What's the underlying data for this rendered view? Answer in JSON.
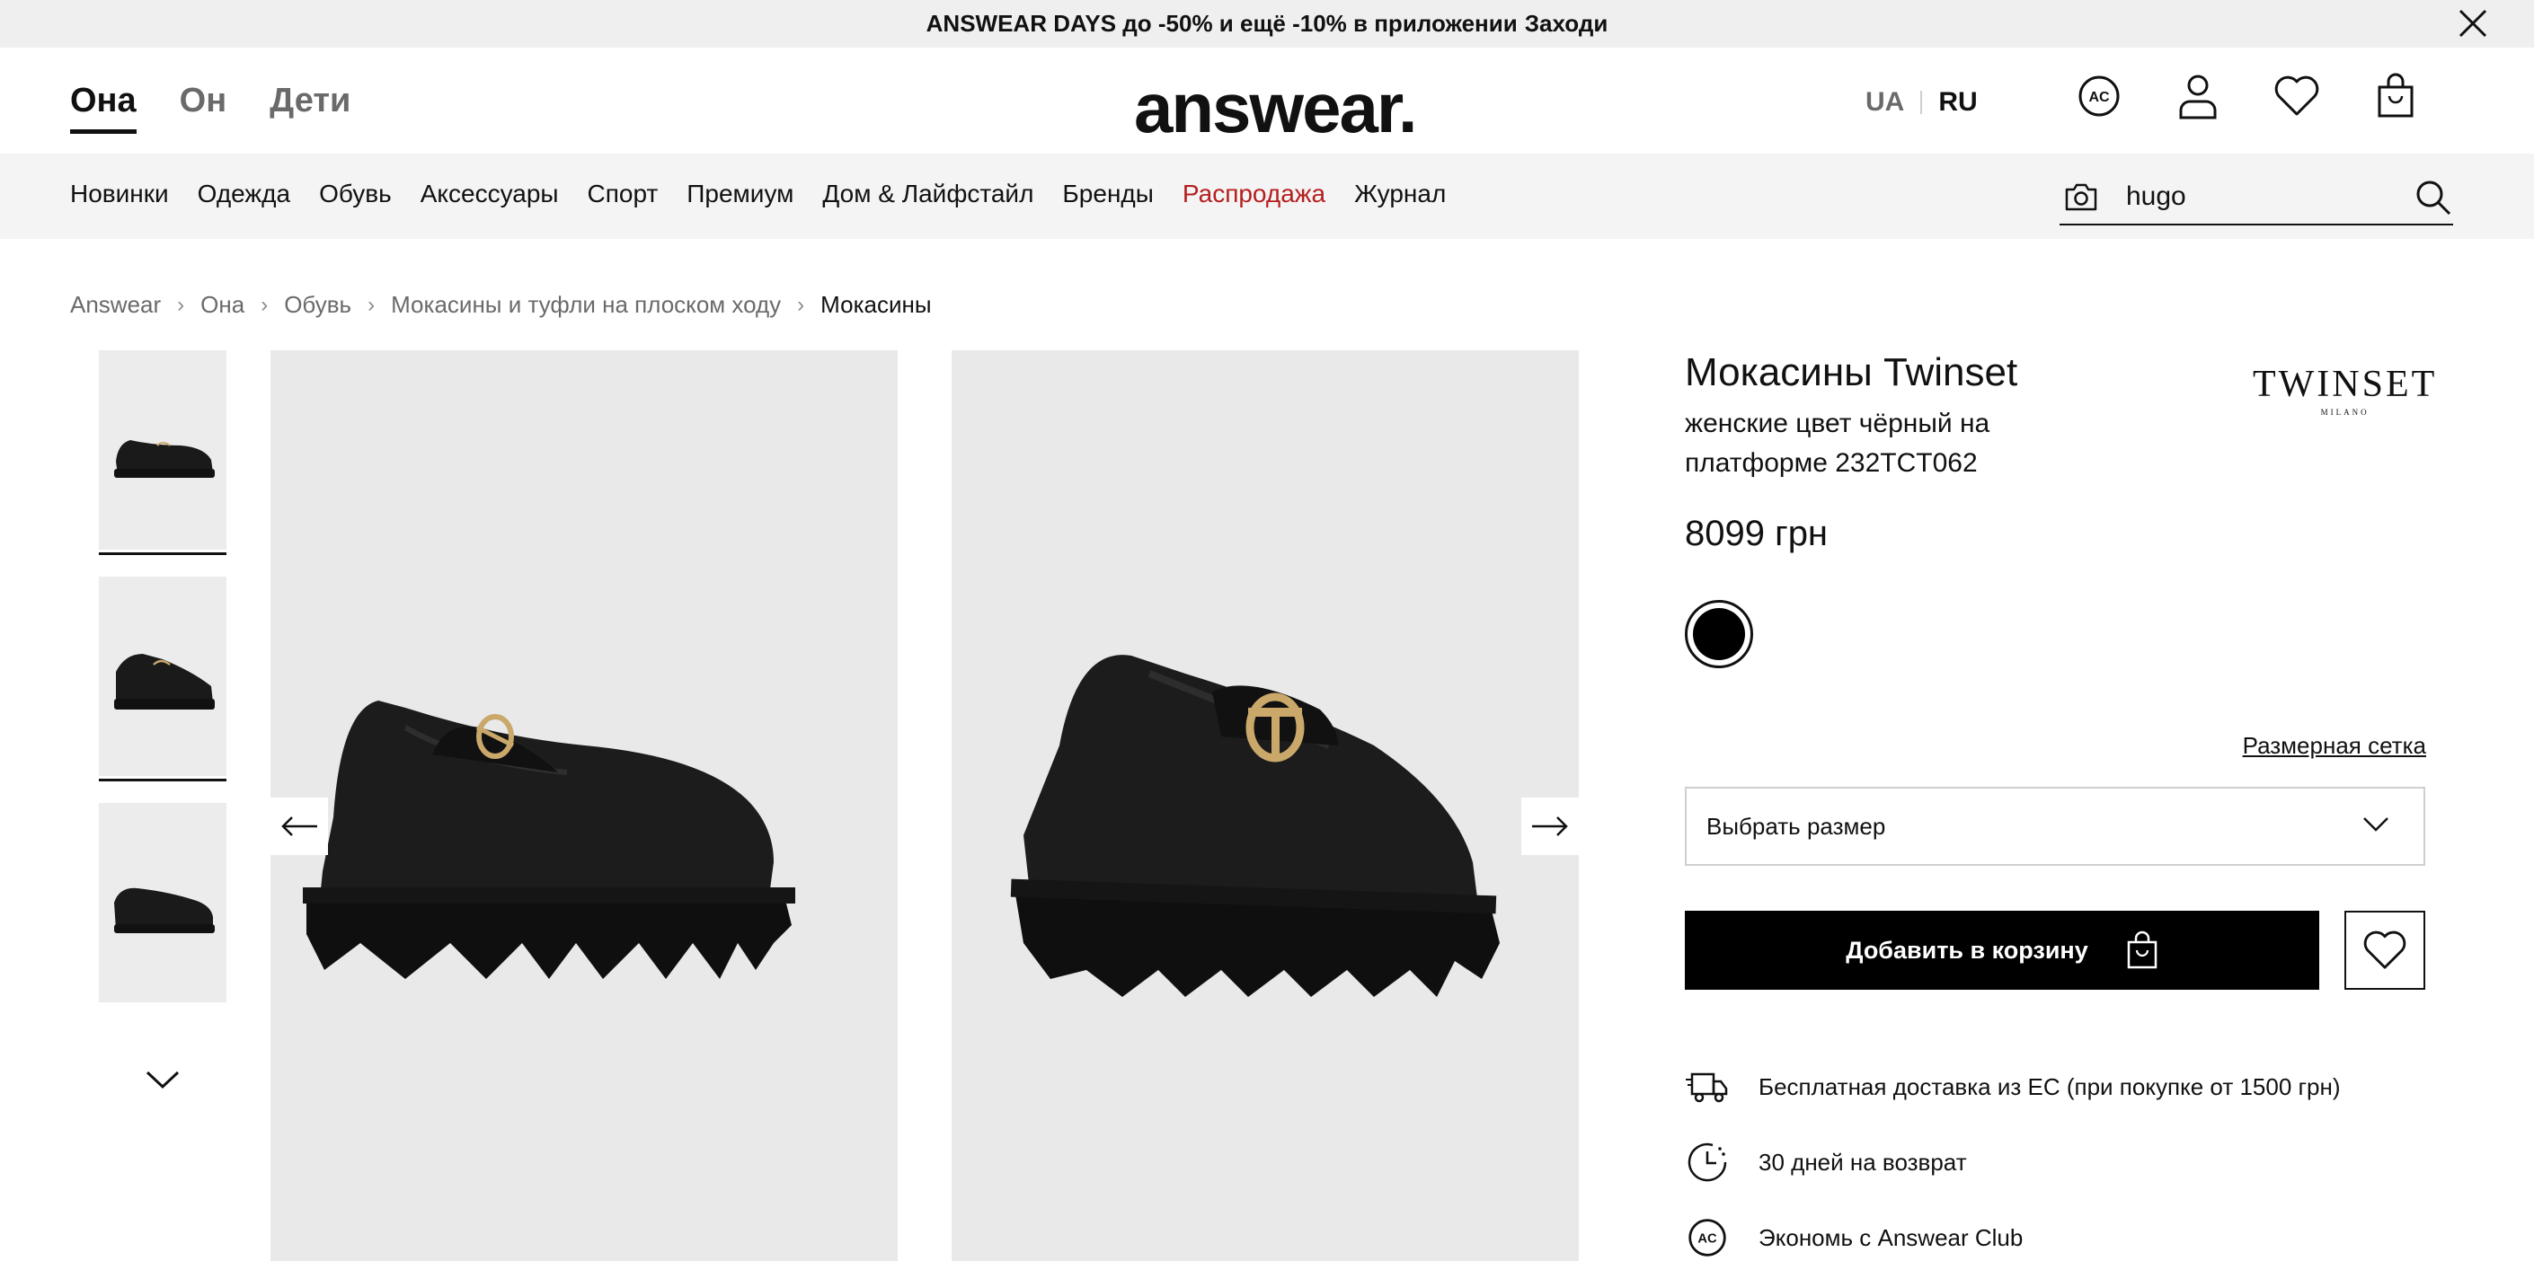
{
  "promo": {
    "text": "ANSWEAR DAYS до -50% и ещё -10% в приложении",
    "link": "Заходи"
  },
  "header": {
    "gender_tabs": [
      "Она",
      "Он",
      "Дети"
    ],
    "active_gender": "Она",
    "logo": "answear.",
    "lang": [
      "UA",
      "RU"
    ],
    "active_lang": "RU",
    "icons": [
      "answear-club-icon",
      "user-icon",
      "heart-icon",
      "bag-icon"
    ]
  },
  "nav": {
    "items": [
      "Новинки",
      "Одежда",
      "Обувь",
      "Аксессуары",
      "Спорт",
      "Премиум",
      "Дом & Лайфстайл",
      "Бренды",
      "Распродажа",
      "Журнал"
    ],
    "sale_color": "#b51e1e",
    "search_value": "hugo"
  },
  "breadcrumb": [
    "Answear",
    "Она",
    "Обувь",
    "Мокасины и туфли на плоском ходу",
    "Мокасины"
  ],
  "product": {
    "title": "Мокасины Twinset",
    "subtitle": "женские цвет чёрный на платформе 232TCT062",
    "price": "8099 грн",
    "brand_logo": "TWINSET",
    "brand_logo_sub": "MILANO",
    "color": "#000000",
    "size_chart_label": "Размерная сетка",
    "size_placeholder": "Выбрать размер",
    "add_to_cart_label": "Добавить в корзину",
    "perks": [
      "Бесплатная доставка из ЕС (при покупке от 1500 грн)",
      "30 дней на возврат",
      "Экономь с Answear Club"
    ]
  },
  "colors": {
    "promo_bg": "#efefef",
    "nav_bg": "#f4f4f4",
    "image_bg": "#e9e9e9",
    "cart_bg": "#000000"
  }
}
